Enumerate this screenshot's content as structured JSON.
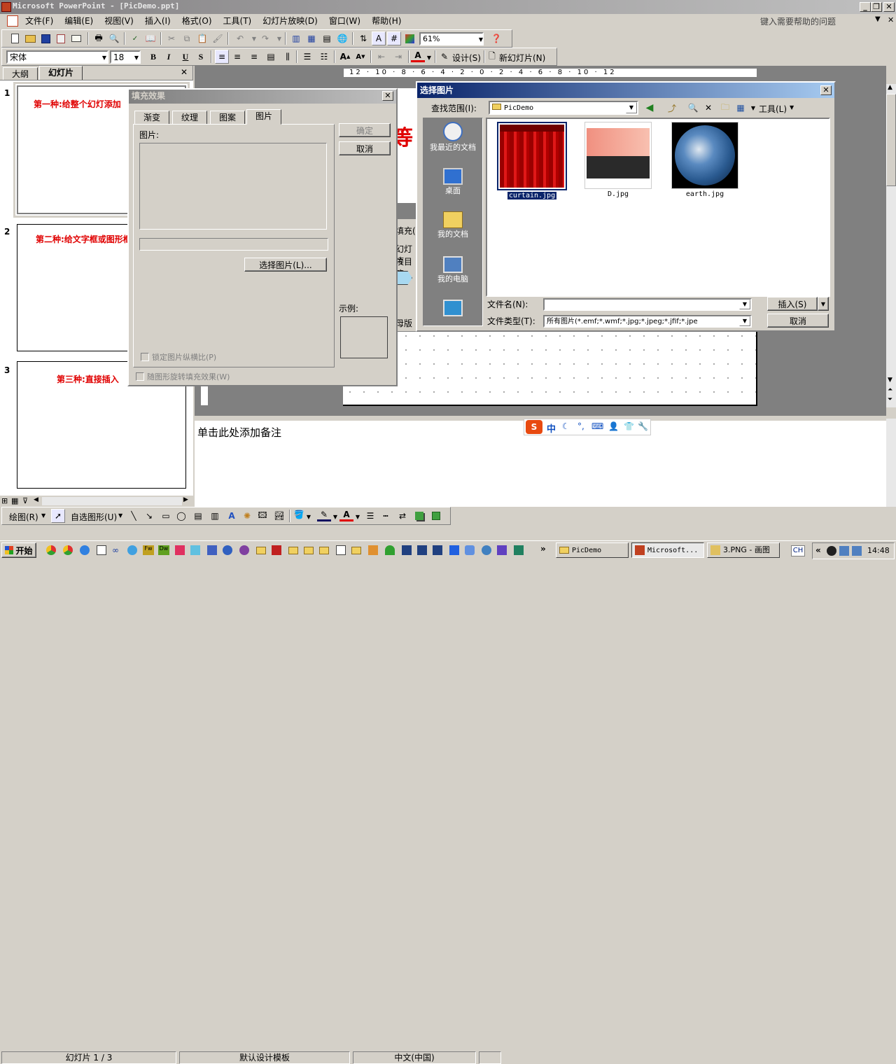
{
  "app": {
    "title": "Microsoft PowerPoint - [PicDemo.ppt]",
    "help_placeholder": "键入需要帮助的问题"
  },
  "menu": [
    "文件(F)",
    "编辑(E)",
    "视图(V)",
    "插入(I)",
    "格式(O)",
    "工具(T)",
    "幻灯片放映(D)",
    "窗口(W)",
    "帮助(H)"
  ],
  "toolbar": {
    "zoom": "61%",
    "font": "宋体",
    "size": "18",
    "design": "设计(S)",
    "new_slide": "新幻灯片(N)"
  },
  "panel": {
    "tab_outline": "大纲",
    "tab_slides": "幻灯片"
  },
  "slides": [
    {
      "num": "1",
      "title": "第一种:给整个幻灯添加"
    },
    {
      "num": "2",
      "title": "第二种:给文字框或图形框"
    },
    {
      "num": "3",
      "title": "第三种:直接插入"
    }
  ],
  "notes": "单击此处添加备注",
  "fill_dialog": {
    "title": "填充效果",
    "tabs": [
      "渐变",
      "纹理",
      "图案",
      "图片"
    ],
    "picture_label": "图片:",
    "select_button": "选择图片(L)...",
    "lock_aspect": "锁定图片纵横比(P)",
    "rotate_with_shape": "随图形旋转填充效果(W)",
    "ok": "确定",
    "cancel": "取消",
    "sample_label": "示例:"
  },
  "behind_text": {
    "fill": "填充(",
    "line1": "幻灯片",
    "line2": "项目符",
    "mother": "母版"
  },
  "insert_dialog": {
    "title": "选择图片",
    "look_in_label": "查找范围(I):",
    "look_in_value": "PicDemo",
    "tools_label": "工具(L)",
    "places": [
      "我最近的文档",
      "桌面",
      "我的文档",
      "我的电脑"
    ],
    "files": [
      {
        "name": "curtain.jpg"
      },
      {
        "name": "D.jpg"
      },
      {
        "name": "earth.jpg"
      }
    ],
    "filename_label": "文件名(N):",
    "filename_value": "",
    "filetype_label": "文件类型(T):",
    "filetype_value": "所有图片(*.emf;*.wmf;*.jpg;*.jpeg;*.jfif;*.jpe",
    "insert_button": "插入(S)",
    "cancel_button": "取消"
  },
  "drawing": {
    "draw": "绘图(R)",
    "autoshapes": "自选图形(U)"
  },
  "status": {
    "slide": "幻灯片 1 / 3",
    "template": "默认设计模板",
    "lang": "中文(中国)"
  },
  "taskbar": {
    "start": "开始",
    "tasks": [
      "PicDemo",
      "Microsoft...",
      "3.PNG - 画图"
    ],
    "time": "14:48",
    "ime": "CH"
  },
  "ime_bar": {
    "mode": "中"
  },
  "ruler": "12 · 10 · 8 · 6 · 4 · 2 · 0 · 2 · 4 · 6 · 8 · 10 · 12"
}
